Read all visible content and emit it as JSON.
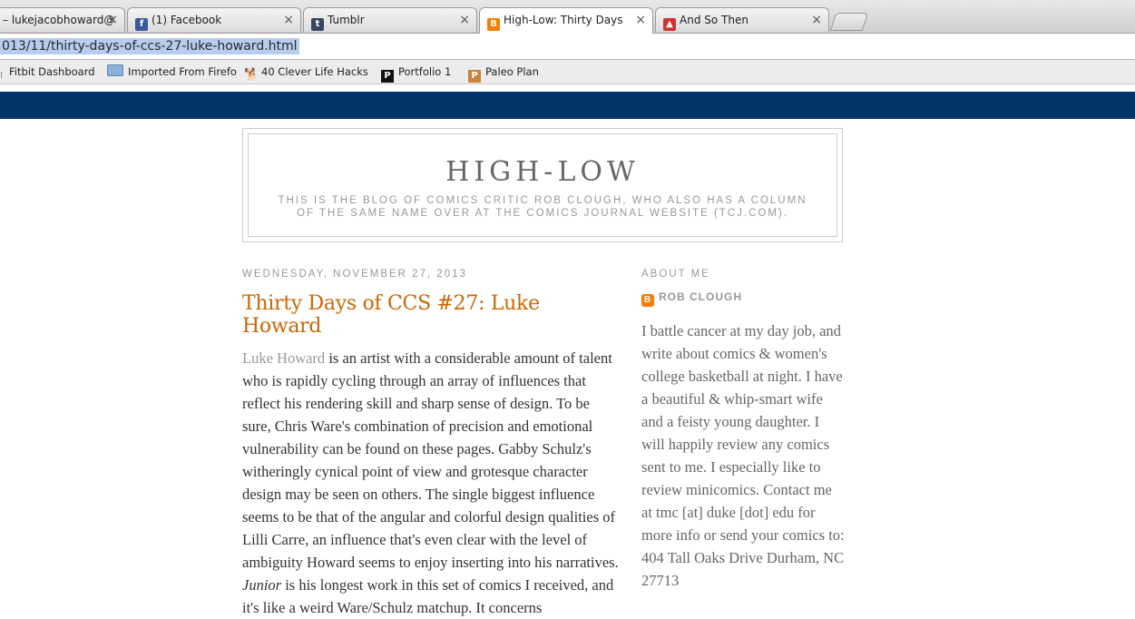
{
  "browser": {
    "tabs": [
      {
        "title": "– lukejacobhoward@",
        "icon": "gmail-icon"
      },
      {
        "title": "(1) Facebook",
        "icon": "facebook-icon"
      },
      {
        "title": "Tumblr",
        "icon": "tumblr-icon"
      },
      {
        "title": "High-Low: Thirty Days of C",
        "icon": "blogger-icon"
      },
      {
        "title": "And So Then",
        "icon": "site-icon"
      }
    ],
    "close_glyph": "×",
    "url": "013/11/thirty-days-of-ccs-27-luke-howard.html",
    "bookmarks": [
      {
        "label": "Fitbit Dashboard",
        "icon": "fitbit-icon"
      },
      {
        "label": "Imported From Firefo",
        "icon": "folder-icon"
      },
      {
        "label": "40 Clever Life Hacks",
        "icon": "dog-icon"
      },
      {
        "label": "Portfolio 1",
        "icon": "p-black-icon"
      },
      {
        "label": "Paleo Plan",
        "icon": "p-brown-icon"
      }
    ]
  },
  "blog": {
    "title": "HIGH-LOW",
    "description": "This is the blog of comics critic Rob Clough, who also has a column of the same name over at the Comics Journal website (tcj.com).",
    "post": {
      "date": "Wednesday, November 27, 2013",
      "title": "Thirty Days of CCS #27: Luke Howard",
      "author_link": "Luke Howard",
      "body_1": " is an artist with a considerable amount of talent who is rapidly cycling through an array of influences that reflect his rendering skill and sharp sense of design. To be sure, Chris Ware's combination of precision and emotional vulnerability can be found on these pages. Gabby Schulz's witheringly cynical point of view and grotesque character design may be seen on others. The single biggest influence seems to be that of the angular and colorful design qualities of Lilli Carre, an influence that's even clear with the level of ambiguity Howard seems to enjoy inserting into his narratives. ",
      "italic": "Junior",
      "body_2": " is his longest work in this set of comics I received, and it's like a weird Ware/Schulz matchup. It concerns"
    },
    "sidebar": {
      "heading": "About Me",
      "profile_name": "Rob Clough",
      "about": "I battle cancer at my day job, and write about comics & women's college basketball at night. I have a beautiful & whip-smart wife and a feisty young daughter. I will happily review any comics sent to me. I especially like to review minicomics. Contact me at tmc [at] duke [dot] edu for more info or send your comics to: 404 Tall Oaks Drive Durham, NC 27713"
    },
    "colors": {
      "navbar": "#003366",
      "post_title": "#cc6600"
    }
  }
}
